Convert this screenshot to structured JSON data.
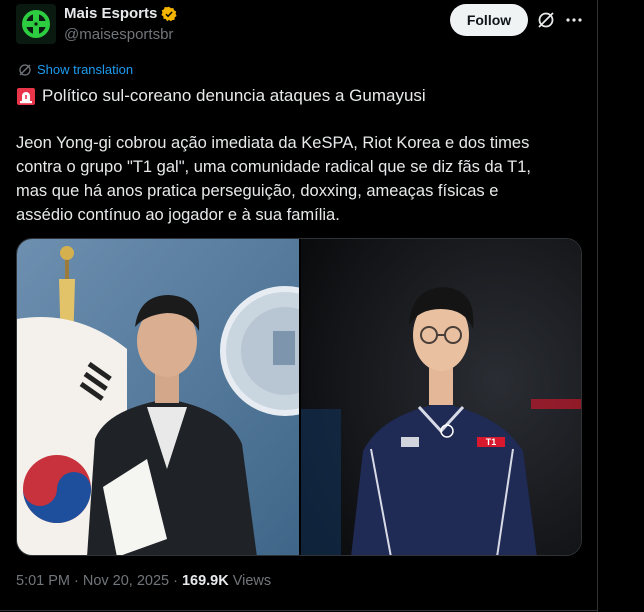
{
  "account": {
    "display_name": "Mais Esports",
    "handle": "@maisesportsbr",
    "verified_color": "#f4b400",
    "avatar_color": "#2ecc40"
  },
  "actions": {
    "follow_label": "Follow",
    "grok_icon": "grok-slash-icon",
    "more_icon": "more-dots-icon"
  },
  "translation": {
    "label": "Show translation",
    "icon": "translate-globe-icon"
  },
  "post": {
    "headline_emoji": "siren-icon",
    "headline": "Político sul-coreano denuncia ataques a Gumayusi",
    "body_lines": [
      "Jeon Yong-gi cobrou ação imediata da KeSPA, Riot Korea e dos times",
      "contra o grupo \"T1 gal\", uma comunidade radical que se diz fãs da T1,",
      "mas que há anos pratica perseguição, doxxing, ameaças físicas e",
      "assédio contínuo ao jogador e à sua família."
    ]
  },
  "media": {
    "photo_left_desc": "politician-press-conference",
    "photo_right_desc": "player-in-jersey",
    "jersey_brand": "T1",
    "jersey_sponsor": "SAMSUNG Odyssey"
  },
  "footer": {
    "time": "5:01 PM",
    "separator": "·",
    "date": "Nov 20, 2025",
    "separator2": "·",
    "views_count": "169.9K",
    "views_label": "Views"
  }
}
